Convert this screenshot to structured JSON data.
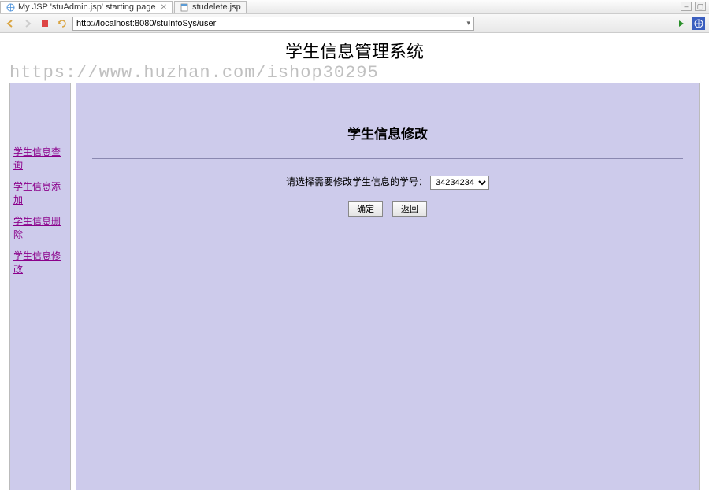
{
  "tabs": [
    {
      "label": "My JSP 'stuAdmin.jsp' starting page",
      "active": true,
      "closeable": true
    },
    {
      "label": "studelete.jsp",
      "active": false,
      "closeable": false
    }
  ],
  "toolbar": {
    "url": "http://localhost:8080/stuInfoSys/user"
  },
  "header": {
    "sys_title": "学生信息管理系统",
    "watermark": "https://www.huzhan.com/ishop30295"
  },
  "sidebar": {
    "links": [
      "学生信息查询",
      "学生信息添加",
      "学生信息删除",
      "学生信息修改"
    ]
  },
  "main": {
    "title": "学生信息修改",
    "prompt_label": "请选择需要修改学生信息的学号：",
    "selected_id": "34234234",
    "confirm_label": "确定",
    "back_label": "返回"
  }
}
